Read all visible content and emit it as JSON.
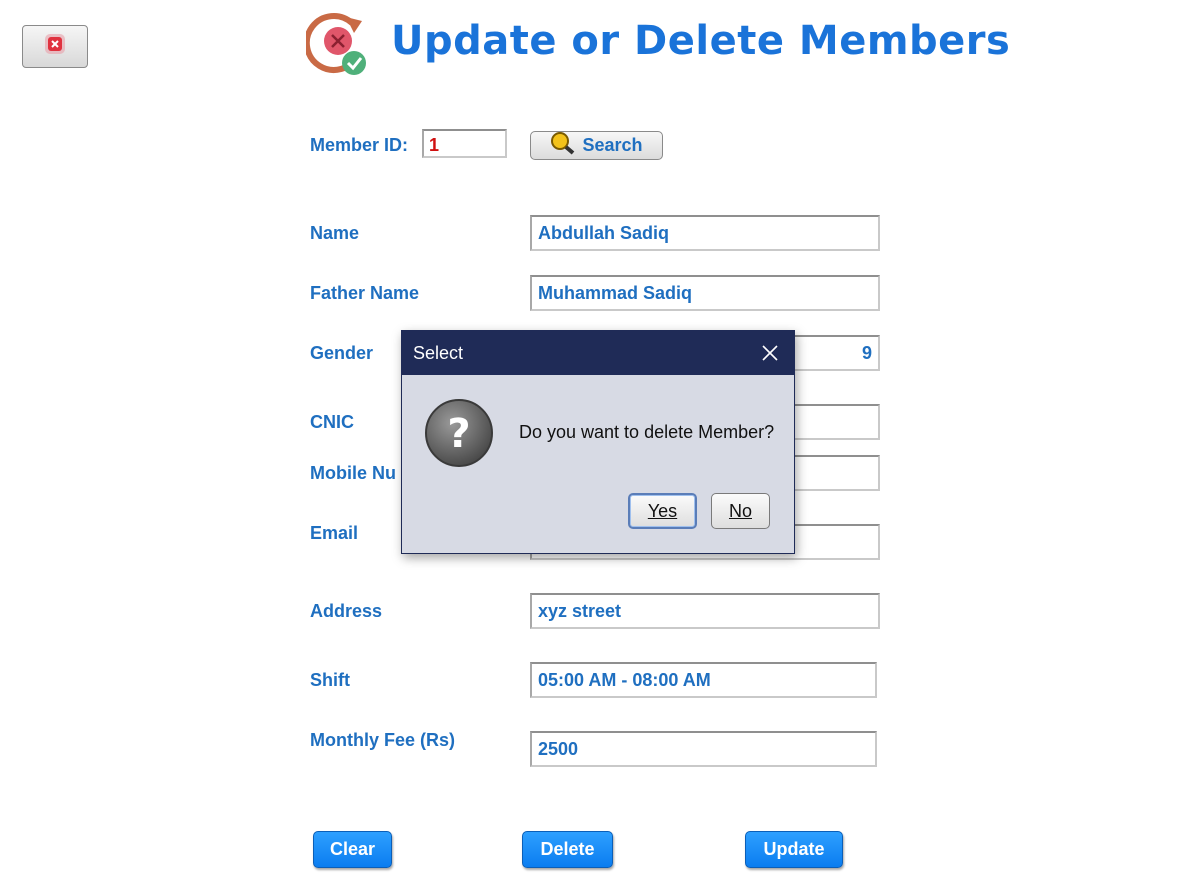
{
  "header": {
    "title": "Update or Delete Members",
    "icon": "update-delete-icon"
  },
  "close_button": {
    "icon": "close-icon"
  },
  "search": {
    "label": "Member ID:",
    "value": "1",
    "button_label": "Search",
    "button_icon": "magnifier-icon"
  },
  "form": {
    "name_label": "Name",
    "name_value": "Abdullah Sadiq",
    "father_label": "Father Name",
    "father_value": "Muhammad Sadiq",
    "gender_label": "Gender",
    "gender_partial": "9",
    "cnic_label": "CNIC",
    "mobile_label": "Mobile Nu",
    "email_label": "Email",
    "address_label": "Address",
    "address_value": "xyz street",
    "shift_label": "Shift",
    "shift_value": "05:00 AM - 08:00 AM",
    "fee_label": "Monthly Fee (Rs)",
    "fee_value": "2500"
  },
  "actions": {
    "clear": "Clear",
    "delete": "Delete",
    "update": "Update"
  },
  "dialog": {
    "title": "Select",
    "message": "Do you want to delete Member?",
    "yes_label": "Yes",
    "no_label": "No",
    "icon": "question-icon"
  },
  "colors": {
    "accent": "#1a73d9",
    "label": "#1f6fc0",
    "dialog_header": "#1f2b57",
    "button": "#1483f5"
  }
}
